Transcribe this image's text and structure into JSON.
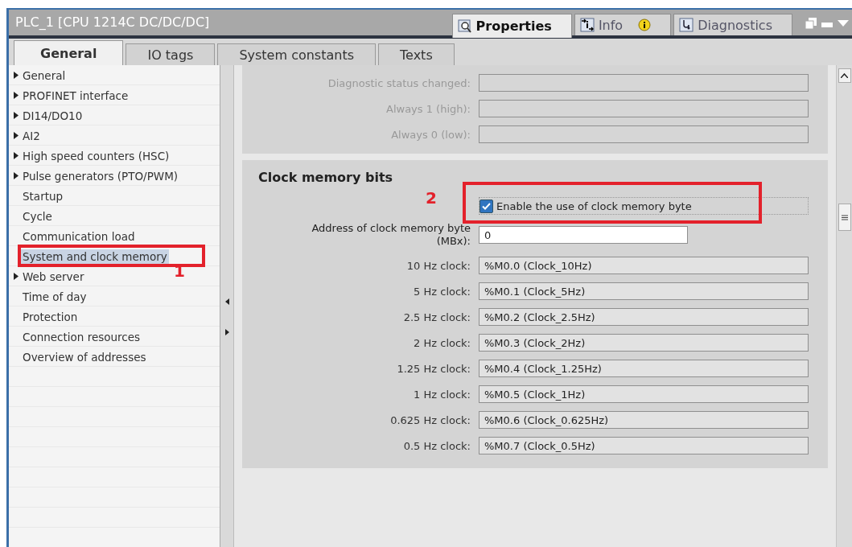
{
  "window": {
    "title": "PLC_1 [CPU 1214C DC/DC/DC]"
  },
  "panel_tabs": [
    {
      "label": "Properties",
      "selected": true
    },
    {
      "label": "Info",
      "selected": false
    },
    {
      "label": "Diagnostics",
      "selected": false
    }
  ],
  "tabs": [
    {
      "label": "General",
      "selected": true
    },
    {
      "label": "IO tags",
      "selected": false
    },
    {
      "label": "System constants",
      "selected": false
    },
    {
      "label": "Texts",
      "selected": false
    }
  ],
  "nav": [
    {
      "label": "General",
      "expandable": true,
      "selected": false
    },
    {
      "label": "PROFINET interface",
      "expandable": true,
      "selected": false
    },
    {
      "label": "DI14/DO10",
      "expandable": true,
      "selected": false
    },
    {
      "label": "AI2",
      "expandable": true,
      "selected": false
    },
    {
      "label": "High speed counters (HSC)",
      "expandable": true,
      "selected": false
    },
    {
      "label": "Pulse generators (PTO/PWM)",
      "expandable": true,
      "selected": false
    },
    {
      "label": "Startup",
      "expandable": false,
      "selected": false
    },
    {
      "label": "Cycle",
      "expandable": false,
      "selected": false
    },
    {
      "label": "Communication load",
      "expandable": false,
      "selected": false
    },
    {
      "label": "System and clock memory",
      "expandable": false,
      "selected": true,
      "annotation": "1"
    },
    {
      "label": "Web server",
      "expandable": true,
      "selected": false
    },
    {
      "label": "Time of day",
      "expandable": false,
      "selected": false
    },
    {
      "label": "Protection",
      "expandable": false,
      "selected": false
    },
    {
      "label": "Connection resources",
      "expandable": false,
      "selected": false
    },
    {
      "label": "Overview of addresses",
      "expandable": false,
      "selected": false
    }
  ],
  "system_fields": [
    {
      "label": "Diagnostic status changed:",
      "disabled": true
    },
    {
      "label": "Always 1 (high):",
      "disabled": true
    },
    {
      "label": "Always 0 (low):",
      "disabled": true
    }
  ],
  "clock_section": {
    "title": "Clock memory bits",
    "enable": {
      "label": "Enable the use of clock memory byte",
      "checked": true,
      "annotation": "2"
    },
    "address": {
      "label_lines": [
        "Address of clock memory byte",
        "(MBx):"
      ],
      "value": "0"
    },
    "clocks": [
      {
        "label": "10 Hz clock:",
        "value": "%M0.0 (Clock_10Hz)"
      },
      {
        "label": "5 Hz clock:",
        "value": "%M0.1 (Clock_5Hz)"
      },
      {
        "label": "2.5 Hz clock:",
        "value": "%M0.2 (Clock_2.5Hz)"
      },
      {
        "label": "2 Hz clock:",
        "value": "%M0.3 (Clock_2Hz)"
      },
      {
        "label": "1.25 Hz clock:",
        "value": "%M0.4 (Clock_1.25Hz)"
      },
      {
        "label": "1 Hz clock:",
        "value": "%M0.5 (Clock_1Hz)"
      },
      {
        "label": "0.625 Hz clock:",
        "value": "%M0.6 (Clock_0.625Hz)"
      },
      {
        "label": "0.5 Hz clock:",
        "value": "%M0.7 (Clock_0.5Hz)"
      }
    ]
  }
}
